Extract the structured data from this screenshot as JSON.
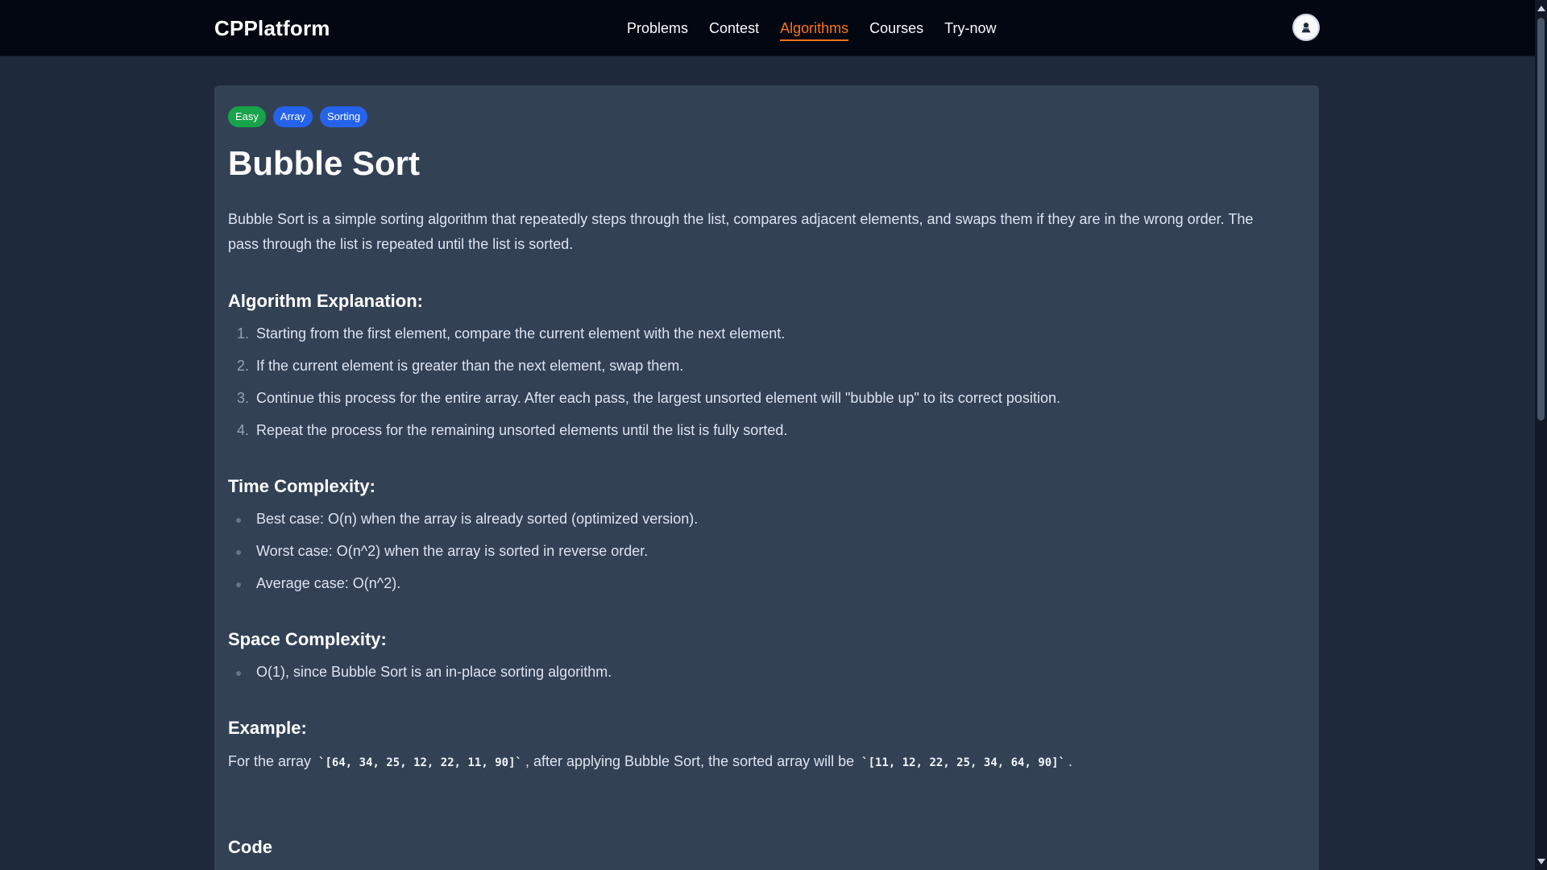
{
  "header": {
    "brand": "CPPlatform",
    "nav": [
      {
        "label": "Problems",
        "active": false
      },
      {
        "label": "Contest",
        "active": false
      },
      {
        "label": "Algorithms",
        "active": true
      },
      {
        "label": "Courses",
        "active": false
      },
      {
        "label": "Try-now",
        "active": false
      }
    ],
    "avatar_icon": "user-avatar-icon"
  },
  "article": {
    "tags": [
      "Easy",
      "Array",
      "Sorting"
    ],
    "title": "Bubble Sort",
    "intro": "Bubble Sort is a simple sorting algorithm that repeatedly steps through the list, compares adjacent elements, and swaps them if they are in the wrong order. The pass through the list is repeated until the list is sorted.",
    "algorithm_title": "Algorithm Explanation:",
    "algorithm_steps": [
      "Starting from the first element, compare the current element with the next element.",
      "If the current element is greater than the next element, swap them.",
      "Continue this process for the entire array. After each pass, the largest unsorted element will \"bubble up\" to its correct position.",
      "Repeat the process for the remaining unsorted elements until the list is fully sorted."
    ],
    "time_title": "Time Complexity:",
    "time_items": [
      "Best case: O(n) when the array is already sorted (optimized version).",
      "Worst case: O(n^2) when the array is sorted in reverse order.",
      "Average case: O(n^2)."
    ],
    "space_title": "Space Complexity:",
    "space_items": [
      "O(1), since Bubble Sort is an in-place sorting algorithm."
    ],
    "example_title": "Example:",
    "example": {
      "prefix": "For the array",
      "input": "`[64, 34, 25, 12, 22, 11, 90]`",
      "middle": ", after applying Bubble Sort, the sorted array will be",
      "output": "`[11, 12, 22, 25, 34, 64, 90]`",
      "suffix": "."
    },
    "code_title": "Code"
  },
  "colors": {
    "navbar_bg": "#030712",
    "page_bg": "#1e293b",
    "card_bg": "#334155",
    "active_nav": "#f97316",
    "easy_tag": "#16a34a",
    "topic_tag": "#2563eb"
  }
}
